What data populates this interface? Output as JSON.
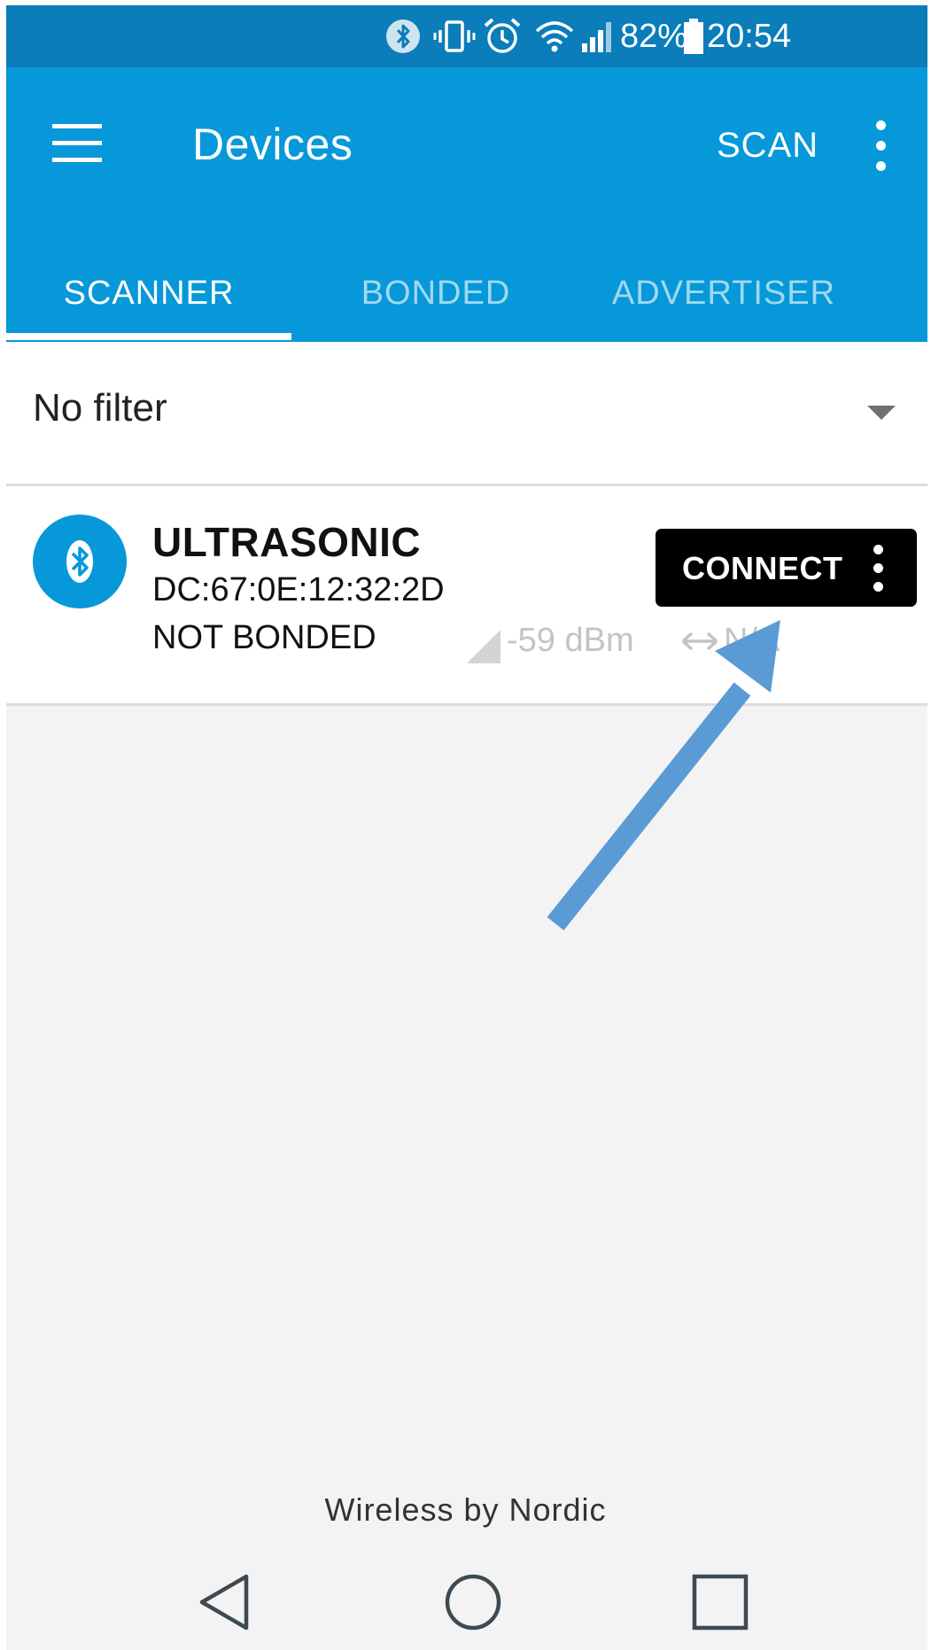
{
  "status_bar": {
    "battery_percent": "82%",
    "time": "20:54",
    "icons": [
      "bluetooth-icon",
      "vibrate-icon",
      "alarm-icon",
      "wifi-icon",
      "cell-signal-icon",
      "battery-icon"
    ]
  },
  "app_bar": {
    "title": "Devices",
    "scan_label": "SCAN",
    "menu_icon": "hamburger-icon",
    "overflow_icon": "more-vert-icon"
  },
  "tabs": [
    {
      "label": "SCANNER",
      "selected": true
    },
    {
      "label": "BONDED",
      "selected": false
    },
    {
      "label": "ADVERTISER",
      "selected": false
    }
  ],
  "filter": {
    "label": "No filter",
    "icon": "dropdown-caret-icon"
  },
  "devices": [
    {
      "name": "ULTRASONIC",
      "address": "DC:67:0E:12:32:2D",
      "bond_state": "NOT BONDED",
      "rssi": "-59 dBm",
      "interval": "N/A",
      "connect_label": "CONNECT",
      "icon": "bluetooth-icon"
    }
  ],
  "footer": {
    "brand": "Wireless by Nordic"
  },
  "nav_bar": [
    "back-icon",
    "home-icon",
    "recents-icon"
  ],
  "colors": {
    "status_bar": "#0a7dba",
    "primary": "#0698d9",
    "annotation_arrow": "#5b9bd5",
    "connect_button": "#000000",
    "background": "#f3f3f4"
  }
}
